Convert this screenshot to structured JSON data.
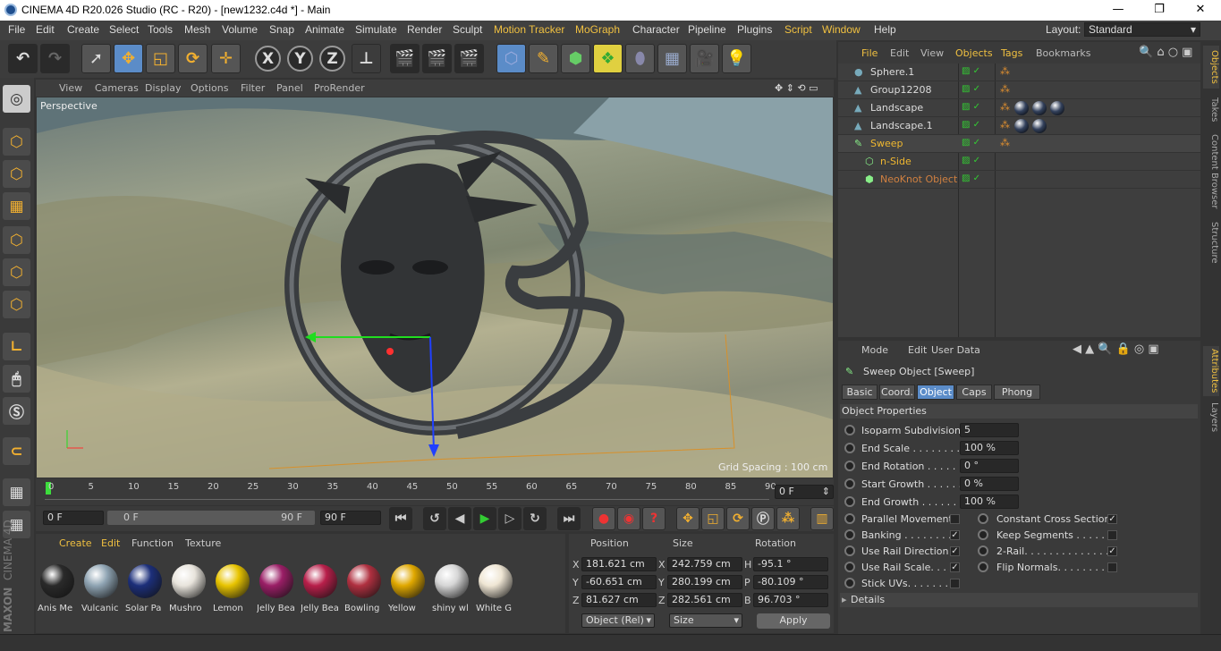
{
  "titlebar": {
    "title": "CINEMA 4D R20.026 Studio (RC - R20) - [new1232.c4d *] - Main",
    "minimize": "—",
    "maximize": "❐",
    "close": "✕"
  },
  "menubar": {
    "items": [
      "File",
      "Edit",
      "Create",
      "Select",
      "Tools",
      "Mesh",
      "Volume",
      "Snap",
      "Animate",
      "Simulate",
      "Render",
      "Sculpt",
      "Motion Tracker",
      "MoGraph",
      "Character",
      "Pipeline",
      "Plugins",
      "Script",
      "Window",
      "Help"
    ],
    "layout_label": "Layout:",
    "layout_value": "Standard"
  },
  "toolbar": {
    "x": "X",
    "y": "Y",
    "z": "Z"
  },
  "viewport": {
    "menu": [
      "View",
      "Cameras",
      "Display",
      "Options",
      "Filter",
      "Panel",
      "ProRender"
    ],
    "label": "Perspective",
    "grid_spacing": "Grid Spacing : 100 cm"
  },
  "timeline": {
    "ticks": [
      "0",
      "5",
      "10",
      "15",
      "20",
      "25",
      "30",
      "35",
      "40",
      "45",
      "50",
      "55",
      "60",
      "65",
      "70",
      "75",
      "80",
      "85",
      "90"
    ],
    "current_frame_field": "0 F",
    "start_field": "0 F",
    "range_start": "0 F",
    "range_end": "90 F",
    "end_field": "90 F"
  },
  "materials": {
    "menu": [
      "Create",
      "Edit",
      "Function",
      "Texture"
    ],
    "items": [
      {
        "label": "Anis Me",
        "color": "#2a2a2a"
      },
      {
        "label": "Vulcanic",
        "color": "#8fa4b3"
      },
      {
        "label": "Solar Pa",
        "color": "#1c2f7a"
      },
      {
        "label": "Mushro",
        "color": "#e8e4dc"
      },
      {
        "label": "Lemon",
        "color": "#e8c400"
      },
      {
        "label": "Jelly Bea",
        "color": "#9a1e66"
      },
      {
        "label": "Jelly Bea",
        "color": "#b81f4a"
      },
      {
        "label": "Bowling",
        "color": "#b03040"
      },
      {
        "label": "Yellow",
        "color": "#e0a800"
      },
      {
        "label": "shiny wl",
        "color": "#d6d6d6"
      },
      {
        "label": "White G",
        "color": "#efe6d4"
      }
    ]
  },
  "coordinates": {
    "headers": {
      "position": "Position",
      "size": "Size",
      "rotation": "Rotation"
    },
    "rows": [
      {
        "axis": "X",
        "pos": "181.621 cm",
        "saxis": "X",
        "size": "242.759 cm",
        "raxis": "H",
        "rot": "-95.1 °"
      },
      {
        "axis": "Y",
        "pos": "-60.651 cm",
        "saxis": "Y",
        "size": "280.199 cm",
        "raxis": "P",
        "rot": "-80.109 °"
      },
      {
        "axis": "Z",
        "pos": "81.627 cm",
        "saxis": "Z",
        "size": "282.561 cm",
        "raxis": "B",
        "rot": "96.703 °"
      }
    ],
    "mode": "Object (Rel)",
    "size_mode": "Size",
    "apply": "Apply"
  },
  "objects": {
    "menu": [
      "File",
      "Edit",
      "View",
      "Objects",
      "Tags",
      "Bookmarks"
    ],
    "rows": [
      {
        "name": "Sphere.1",
        "color": "#ddd"
      },
      {
        "name": "Group12208",
        "color": "#ddd"
      },
      {
        "name": "Landscape",
        "color": "#ddd"
      },
      {
        "name": "Landscape.1",
        "color": "#ddd"
      },
      {
        "name": "Sweep",
        "color": "#f0b830"
      },
      {
        "name": "n-Side",
        "color": "#f0b830"
      },
      {
        "name": "NeoKnot Object",
        "color": "#d08040"
      }
    ]
  },
  "attributes": {
    "menu": [
      "Mode",
      "Edit",
      "User Data"
    ],
    "object_title": "Sweep Object [Sweep]",
    "tabs": [
      "Basic",
      "Coord.",
      "Object",
      "Caps",
      "Phong"
    ],
    "section": "Object Properties",
    "props": [
      {
        "label": "Isoparm Subdivision",
        "value": "5"
      },
      {
        "label": "End Scale . . . . . . . . . .",
        "value": "100 %"
      },
      {
        "label": "End Rotation . . . . . . .",
        "value": "0 °"
      },
      {
        "label": "Start Growth . . . . . . .",
        "value": "0 %"
      },
      {
        "label": "End Growth . . . . . . . .",
        "value": "100 %"
      }
    ],
    "checks_left": [
      {
        "label": "Parallel Movement",
        "checked": false
      },
      {
        "label": "Banking . . . . . . . . .",
        "checked": true
      },
      {
        "label": "Use Rail Direction",
        "checked": true
      },
      {
        "label": "Use Rail Scale. . . .",
        "checked": true
      },
      {
        "label": "Stick UVs. . . . . . . .",
        "checked": false
      }
    ],
    "checks_right": [
      {
        "label": "Constant Cross Section",
        "checked": true
      },
      {
        "label": "Keep Segments . . . . . .",
        "checked": false
      },
      {
        "label": "2-Rail. . . . . . . . . . . . . .",
        "checked": true
      },
      {
        "label": "Flip Normals. . . . . . . . .",
        "checked": false
      }
    ],
    "details": "Details"
  },
  "sidetabs": {
    "objects": "Objects",
    "takes": "Takes",
    "content_browser": "Content Browser",
    "structure": "Structure",
    "attributes": "Attributes",
    "layers": "Layers"
  },
  "brand": {
    "maxon": "MAXON",
    "cinema": "CINEMA 4D"
  }
}
